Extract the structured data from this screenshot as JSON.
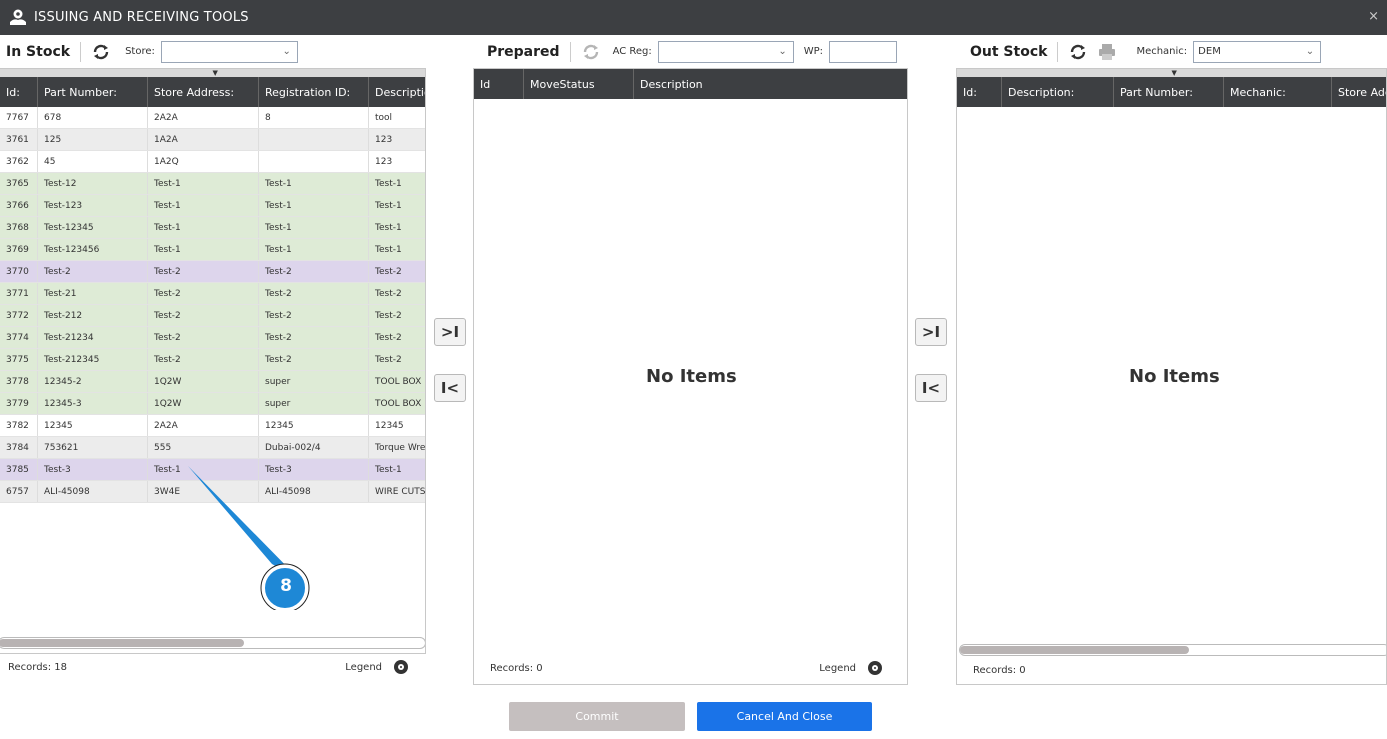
{
  "window": {
    "title": "ISSUING AND RECEIVING TOOLS",
    "close": "×"
  },
  "in_stock": {
    "title": "In Stock",
    "store_label": "Store:",
    "store_value": "",
    "columns": [
      "Id:",
      "Part Number:",
      "Store Address:",
      "Registration ID:",
      "Description"
    ],
    "rows": [
      {
        "id": "7767",
        "part": "678",
        "addr": "2A2A",
        "reg": "8",
        "desc": "tool",
        "color": "white"
      },
      {
        "id": "3761",
        "part": "125",
        "addr": "1A2A",
        "reg": "",
        "desc": "123",
        "color": "gray"
      },
      {
        "id": "3762",
        "part": "45",
        "addr": "1A2Q",
        "reg": "",
        "desc": "123",
        "color": "white"
      },
      {
        "id": "3765",
        "part": "Test-12",
        "addr": "Test-1",
        "reg": "Test-1",
        "desc": "Test-1",
        "color": "green"
      },
      {
        "id": "3766",
        "part": "Test-123",
        "addr": "Test-1",
        "reg": "Test-1",
        "desc": "Test-1",
        "color": "green"
      },
      {
        "id": "3768",
        "part": "Test-12345",
        "addr": "Test-1",
        "reg": "Test-1",
        "desc": "Test-1",
        "color": "green"
      },
      {
        "id": "3769",
        "part": "Test-123456",
        "addr": "Test-1",
        "reg": "Test-1",
        "desc": "Test-1",
        "color": "green"
      },
      {
        "id": "3770",
        "part": "Test-2",
        "addr": "Test-2",
        "reg": "Test-2",
        "desc": "Test-2",
        "color": "purple"
      },
      {
        "id": "3771",
        "part": "Test-21",
        "addr": "Test-2",
        "reg": "Test-2",
        "desc": "Test-2",
        "color": "green"
      },
      {
        "id": "3772",
        "part": "Test-212",
        "addr": "Test-2",
        "reg": "Test-2",
        "desc": "Test-2",
        "color": "green"
      },
      {
        "id": "3774",
        "part": "Test-21234",
        "addr": "Test-2",
        "reg": "Test-2",
        "desc": "Test-2",
        "color": "green"
      },
      {
        "id": "3775",
        "part": "Test-212345",
        "addr": "Test-2",
        "reg": "Test-2",
        "desc": "Test-2",
        "color": "green"
      },
      {
        "id": "3778",
        "part": "12345-2",
        "addr": "1Q2W",
        "reg": "super",
        "desc": "TOOL BOX",
        "color": "green"
      },
      {
        "id": "3779",
        "part": "12345-3",
        "addr": "1Q2W",
        "reg": "super",
        "desc": "TOOL BOX",
        "color": "green"
      },
      {
        "id": "3782",
        "part": "12345",
        "addr": "2A2A",
        "reg": "12345",
        "desc": "12345",
        "color": "white"
      },
      {
        "id": "3784",
        "part": "753621",
        "addr": "555",
        "reg": "Dubai-002/4",
        "desc": "Torque Wren",
        "color": "gray"
      },
      {
        "id": "3785",
        "part": "Test-3",
        "addr": "Test-1",
        "reg": "Test-3",
        "desc": "Test-1",
        "color": "purple"
      },
      {
        "id": "6757",
        "part": "ALI-45098",
        "addr": "3W4E",
        "reg": "ALI-45098",
        "desc": "WIRE CUTS",
        "color": "gray"
      }
    ],
    "records": "Records: 18",
    "legend": "Legend"
  },
  "prepared": {
    "title": "Prepared",
    "ac_reg_label": "AC Reg:",
    "ac_reg_value": "",
    "wp_label": "WP:",
    "wp_value": "",
    "columns": [
      "Id",
      "MoveStatus",
      "Description"
    ],
    "empty_text": "No Items",
    "records": "Records: 0",
    "legend": "Legend"
  },
  "out_stock": {
    "title": "Out Stock",
    "mechanic_label": "Mechanic:",
    "mechanic_value": "DEM",
    "columns": [
      "Id:",
      "Description:",
      "Part Number:",
      "Mechanic:",
      "Store Add"
    ],
    "empty_text": "No Items",
    "records": "Records: 0"
  },
  "move": {
    "to_end": ">I",
    "to_start": "I<"
  },
  "buttons": {
    "commit": "Commit",
    "cancel": "Cancel And Close"
  },
  "callout": {
    "number": "8",
    "color": "#1e88d6"
  },
  "colors": {
    "header_bg": "#3d3f42",
    "green_row": "#deebd6",
    "purple_row": "#ddd5ec",
    "accent": "#1a73e8"
  }
}
